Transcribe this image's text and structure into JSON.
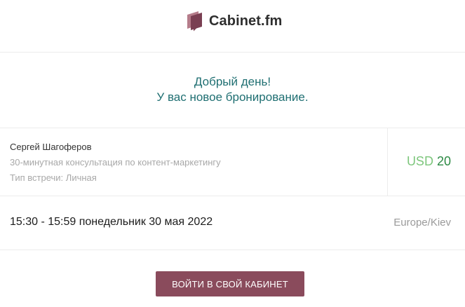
{
  "brand": {
    "name": "Cabinet.fm",
    "logo_icon": "cabinet-logo-icon",
    "color": "#8a4b5c"
  },
  "greeting": {
    "line1": "Добрый день!",
    "line2": "У вас новое бронирование."
  },
  "booking": {
    "client_name": "Сергей Шагоферов",
    "service": "30-минутная консультация по контент-маркетингу",
    "meeting_type": "Тип встречи: Личная",
    "price": {
      "currency": "USD",
      "amount": "20"
    },
    "datetime": "15:30 - 15:59 понедельник 30 мая 2022",
    "timezone": "Europe/Kiev"
  },
  "cta": {
    "label": "ВОЙТИ В СВОЙ КАБИНЕТ"
  },
  "colors": {
    "greeting_text": "#1f6f72",
    "currency": "#7dc67c",
    "amount": "#2d8a44",
    "button_bg": "#8a4b5c"
  }
}
